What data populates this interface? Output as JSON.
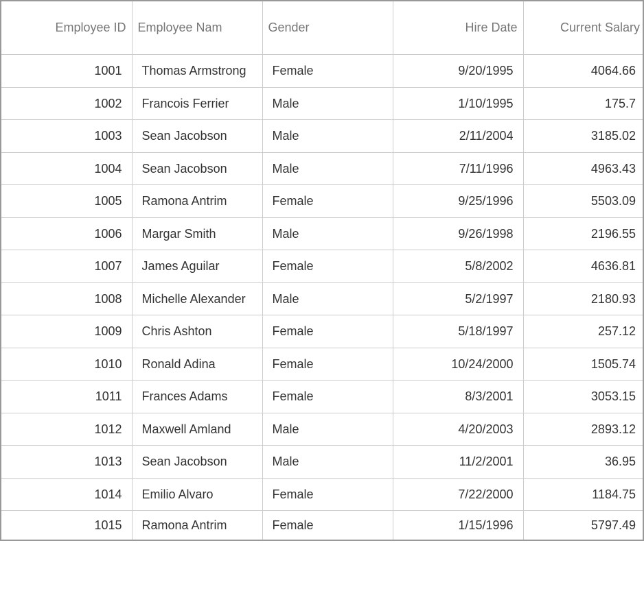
{
  "table": {
    "headers": [
      "Employee ID",
      "Employee Nam",
      "Gender",
      "Hire Date",
      "Current Salary"
    ],
    "rows": [
      {
        "id": "1001",
        "name": "Thomas Armstrong",
        "gender": "Female",
        "date": "9/20/1995",
        "salary": "4064.66"
      },
      {
        "id": "1002",
        "name": "Francois Ferrier",
        "gender": "Male",
        "date": "1/10/1995",
        "salary": "175.7"
      },
      {
        "id": "1003",
        "name": "Sean Jacobson",
        "gender": "Male",
        "date": "2/11/2004",
        "salary": "3185.02"
      },
      {
        "id": "1004",
        "name": "Sean Jacobson",
        "gender": "Male",
        "date": "7/11/1996",
        "salary": "4963.43"
      },
      {
        "id": "1005",
        "name": "Ramona Antrim",
        "gender": "Female",
        "date": "9/25/1996",
        "salary": "5503.09"
      },
      {
        "id": "1006",
        "name": "Margar Smith",
        "gender": "Male",
        "date": "9/26/1998",
        "salary": "2196.55"
      },
      {
        "id": "1007",
        "name": "James Aguilar",
        "gender": "Female",
        "date": "5/8/2002",
        "salary": "4636.81"
      },
      {
        "id": "1008",
        "name": "Michelle Alexander",
        "gender": "Male",
        "date": "5/2/1997",
        "salary": "2180.93"
      },
      {
        "id": "1009",
        "name": "Chris Ashton",
        "gender": "Female",
        "date": "5/18/1997",
        "salary": "257.12"
      },
      {
        "id": "1010",
        "name": "Ronald Adina",
        "gender": "Female",
        "date": "10/24/2000",
        "salary": "1505.74"
      },
      {
        "id": "1011",
        "name": "Frances Adams",
        "gender": "Female",
        "date": "8/3/2001",
        "salary": "3053.15"
      },
      {
        "id": "1012",
        "name": "Maxwell Amland",
        "gender": "Male",
        "date": "4/20/2003",
        "salary": "2893.12"
      },
      {
        "id": "1013",
        "name": "Sean Jacobson",
        "gender": "Male",
        "date": "11/2/2001",
        "salary": "36.95"
      },
      {
        "id": "1014",
        "name": "Emilio Alvaro",
        "gender": "Female",
        "date": "7/22/2000",
        "salary": "1184.75"
      },
      {
        "id": "1015",
        "name": "Ramona Antrim",
        "gender": "Female",
        "date": "1/15/1996",
        "salary": "5797.49"
      }
    ]
  }
}
